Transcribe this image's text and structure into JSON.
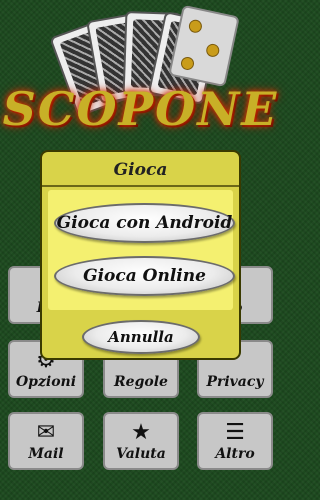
{
  "app": {
    "title": "SCOPONE"
  },
  "dialog": {
    "title": "Gioca",
    "buttons": {
      "android": "Gioca con Android",
      "online": "Gioca Online",
      "cancel": "Annulla"
    }
  },
  "tiles": {
    "left_partial": "Le",
    "right_partial": "lo",
    "opzioni": "Opzioni",
    "regole": "Regole",
    "privacy": "Privacy",
    "mail": "Mail",
    "valuta": "Valuta",
    "altro": "Altro"
  },
  "icons": {
    "opzioni": "gear-icon",
    "mail": "envelope-icon",
    "valuta": "star-icon",
    "altro": "list-icon"
  },
  "colors": {
    "background": "#1d4a1f",
    "dialog": "#d9d349",
    "dialog_inner": "#f4f070",
    "tile": "#c7c7c7",
    "title_text": "#c8b027"
  }
}
